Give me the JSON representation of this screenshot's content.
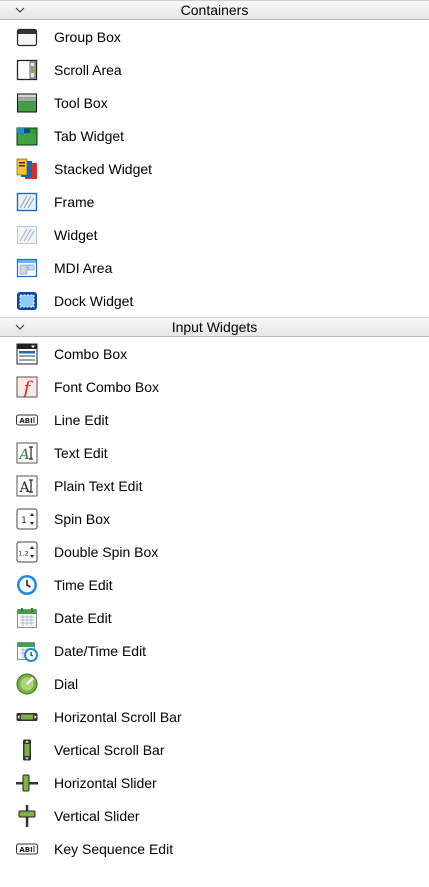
{
  "categories": [
    {
      "title": "Containers",
      "items": [
        {
          "label": "Group Box",
          "icon": "group-box-icon"
        },
        {
          "label": "Scroll Area",
          "icon": "scroll-area-icon"
        },
        {
          "label": "Tool Box",
          "icon": "tool-box-icon"
        },
        {
          "label": "Tab Widget",
          "icon": "tab-widget-icon"
        },
        {
          "label": "Stacked Widget",
          "icon": "stacked-widget-icon"
        },
        {
          "label": "Frame",
          "icon": "frame-icon"
        },
        {
          "label": "Widget",
          "icon": "widget-icon"
        },
        {
          "label": "MDI Area",
          "icon": "mdi-area-icon"
        },
        {
          "label": "Dock Widget",
          "icon": "dock-widget-icon"
        }
      ]
    },
    {
      "title": "Input Widgets",
      "items": [
        {
          "label": "Combo Box",
          "icon": "combo-box-icon"
        },
        {
          "label": "Font Combo Box",
          "icon": "font-combo-box-icon"
        },
        {
          "label": "Line Edit",
          "icon": "line-edit-icon"
        },
        {
          "label": "Text Edit",
          "icon": "text-edit-icon"
        },
        {
          "label": "Plain Text Edit",
          "icon": "plain-text-edit-icon"
        },
        {
          "label": "Spin Box",
          "icon": "spin-box-icon"
        },
        {
          "label": "Double Spin Box",
          "icon": "double-spin-box-icon"
        },
        {
          "label": "Time Edit",
          "icon": "time-edit-icon"
        },
        {
          "label": "Date Edit",
          "icon": "date-edit-icon"
        },
        {
          "label": "Date/Time Edit",
          "icon": "date-time-edit-icon"
        },
        {
          "label": "Dial",
          "icon": "dial-icon"
        },
        {
          "label": "Horizontal Scroll Bar",
          "icon": "horizontal-scroll-bar-icon"
        },
        {
          "label": "Vertical Scroll Bar",
          "icon": "vertical-scroll-bar-icon"
        },
        {
          "label": "Horizontal Slider",
          "icon": "horizontal-slider-icon"
        },
        {
          "label": "Vertical Slider",
          "icon": "vertical-slider-icon"
        },
        {
          "label": "Key Sequence Edit",
          "icon": "key-sequence-edit-icon"
        }
      ]
    }
  ]
}
